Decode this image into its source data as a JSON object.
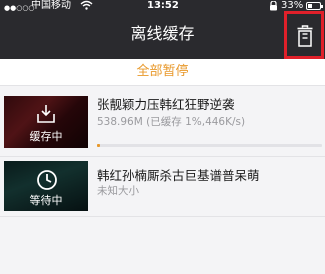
{
  "status_bar": {
    "signal_dots": "●●○○○",
    "carrier": "中国移动",
    "wifi_icon": "wifi-icon",
    "time": "13:52",
    "battery_percent": "33%"
  },
  "header": {
    "title": "离线缓存",
    "delete_icon": "trash-icon",
    "highlight_color": "#e0202a"
  },
  "pause_all": {
    "label": "全部暂停",
    "color": "#e8982a"
  },
  "downloads": [
    {
      "title": "张靓颖力压韩红狂野逆袭",
      "detail": "538.96M (已缓存 1%,446K/s)",
      "status": "缓存中",
      "status_icon": "download-tray-icon",
      "progress": 0.01
    },
    {
      "title": "韩红孙楠厮杀古巨基谱普呆萌",
      "detail": "未知大小",
      "status": "等待中",
      "status_icon": "clock-icon"
    }
  ]
}
